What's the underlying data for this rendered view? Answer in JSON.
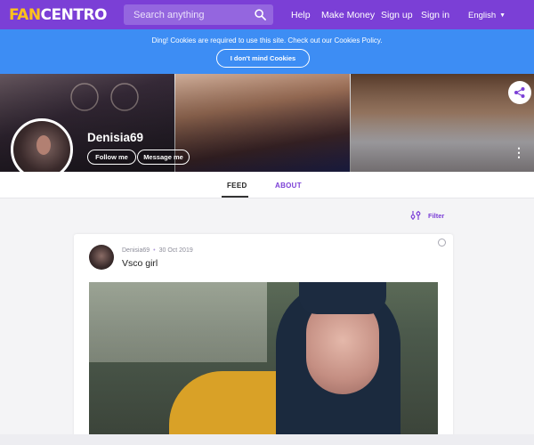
{
  "nav": {
    "logo_fan": "FAN",
    "logo_centro": "CENTRO",
    "search_placeholder": "Search anything",
    "help": "Help",
    "make_money": "Make Money",
    "sign_up": "Sign up",
    "sign_in": "Sign in",
    "language": "English"
  },
  "cookie": {
    "message": "Ding! Cookies are required to use this site. Check out our Cookies Policy.",
    "button": "I don't mind Cookies"
  },
  "profile": {
    "username": "Denisia69",
    "follow": "Follow me",
    "message": "Message me"
  },
  "tabs": {
    "feed": "FEED",
    "about": "ABOUT"
  },
  "filter": {
    "label": "Filter"
  },
  "post": {
    "author": "Denisia69",
    "date": "30 Oct 2019",
    "title": "Vsco girl"
  },
  "colors": {
    "brand_purple": "#7b3fd6",
    "logo_yellow": "#ffc21a",
    "banner_blue": "#3d8df4"
  }
}
